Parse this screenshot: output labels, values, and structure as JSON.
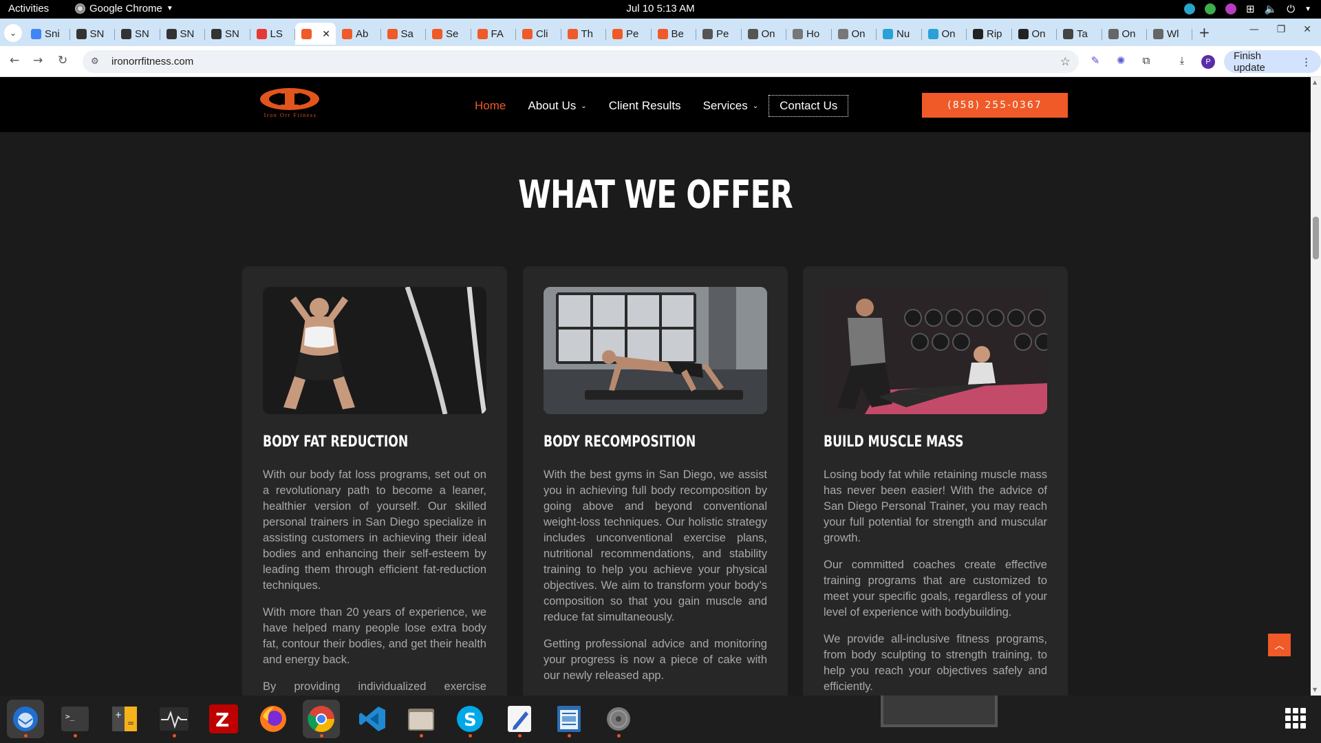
{
  "system": {
    "activities": "Activities",
    "app_name": "Google Chrome",
    "clock": "Jul 10  5:13 AM"
  },
  "tabs": [
    {
      "label": "Sni",
      "icon": "docs-icon",
      "color": "#4285f4"
    },
    {
      "label": "SN",
      "icon": "snp-icon",
      "color": "#333333"
    },
    {
      "label": "SN",
      "icon": "snp-icon",
      "color": "#333333"
    },
    {
      "label": "SN",
      "icon": "snp-icon",
      "color": "#333333"
    },
    {
      "label": "SN",
      "icon": "snp-icon",
      "color": "#333333"
    },
    {
      "label": "LS",
      "icon": "ls-icon",
      "color": "#e53935"
    },
    {
      "label": "",
      "icon": "code-icon",
      "color": "#ef5a28",
      "active": true
    },
    {
      "label": "Ab",
      "icon": "code-icon",
      "color": "#ef5a28"
    },
    {
      "label": "Sa",
      "icon": "code-icon",
      "color": "#ef5a28"
    },
    {
      "label": "Se",
      "icon": "code-icon",
      "color": "#ef5a28"
    },
    {
      "label": "FA",
      "icon": "code-icon",
      "color": "#ef5a28"
    },
    {
      "label": "Cli",
      "icon": "code-icon",
      "color": "#ef5a28"
    },
    {
      "label": "Th",
      "icon": "code-icon",
      "color": "#ef5a28"
    },
    {
      "label": "Pe",
      "icon": "code-icon",
      "color": "#ef5a28"
    },
    {
      "label": "Be",
      "icon": "code-icon",
      "color": "#ef5a28"
    },
    {
      "label": "Pe",
      "icon": "runner-icon",
      "color": "#555555"
    },
    {
      "label": "On",
      "icon": "runner-icon",
      "color": "#555555"
    },
    {
      "label": "Ho",
      "icon": "cat-icon",
      "color": "#777777"
    },
    {
      "label": "On",
      "icon": "cat-icon",
      "color": "#777777"
    },
    {
      "label": "Nu",
      "icon": "globe-icon",
      "color": "#29a0d8"
    },
    {
      "label": "On",
      "icon": "globe-icon",
      "color": "#29a0d8"
    },
    {
      "label": "Rip",
      "icon": "rip-icon",
      "color": "#222222"
    },
    {
      "label": "On",
      "icon": "rip-icon",
      "color": "#222222"
    },
    {
      "label": "Ta",
      "icon": "ta-icon",
      "color": "#444444"
    },
    {
      "label": "On",
      "icon": "page-icon",
      "color": "#666666"
    },
    {
      "label": "Wl",
      "icon": "page-icon",
      "color": "#666666"
    }
  ],
  "address_bar": {
    "url": "ironorrfitness.com",
    "finish_update": "Finish update",
    "profile_initial": "P"
  },
  "site": {
    "logo_text": "Iron Orr Fitness",
    "nav": {
      "home": "Home",
      "about": "About Us",
      "results": "Client Results",
      "services": "Services",
      "contact": "Contact Us"
    },
    "phone": "(858) 255-0367",
    "section_title": "WHAT WE OFFER",
    "cards": [
      {
        "title": "BODY FAT REDUCTION",
        "paragraphs": [
          "With our body fat loss programs, set out on a revolutionary path to become a leaner, healthier version of yourself. Our skilled personal trainers in San Diego specialize in assisting customers in achieving their ideal bodies and enhancing their self-esteem by leading them through efficient fat-reduction techniques.",
          "With more than 20 years of experience, we have helped many people lose extra body fat, contour their bodies, and get their health and energy back.",
          "By providing individualized exercise regimens,"
        ]
      },
      {
        "title": "BODY RECOMPOSITION",
        "paragraphs": [
          "With the best gyms in San Diego, we assist you in achieving full body recomposition by going above and beyond conventional weight-loss techniques. Our holistic strategy includes unconventional exercise plans, nutritional recommendations, and stability training to help you achieve your physical objectives. We aim to transform your body’s composition so that you gain muscle and reduce fat simultaneously.",
          "Getting professional advice and monitoring your progress is now a piece of cake with our newly released app."
        ]
      },
      {
        "title": "BUILD MUSCLE MASS",
        "paragraphs": [
          "Losing body fat while retaining muscle mass has never been easier! With the advice of San Diego Personal Trainer, you may reach your full potential for strength and muscular growth.",
          "Our committed coaches create effective training programs that are customized to meet your specific goals, regardless of your level of experience with bodybuilding.",
          "We provide all-inclusive fitness programs, from body sculpting to strength training, to help you reach your objectives safely and efficiently."
        ]
      }
    ]
  },
  "colors": {
    "accent": "#ef5a28",
    "page_bg": "#1b1b1b",
    "card_bg": "#272727"
  }
}
